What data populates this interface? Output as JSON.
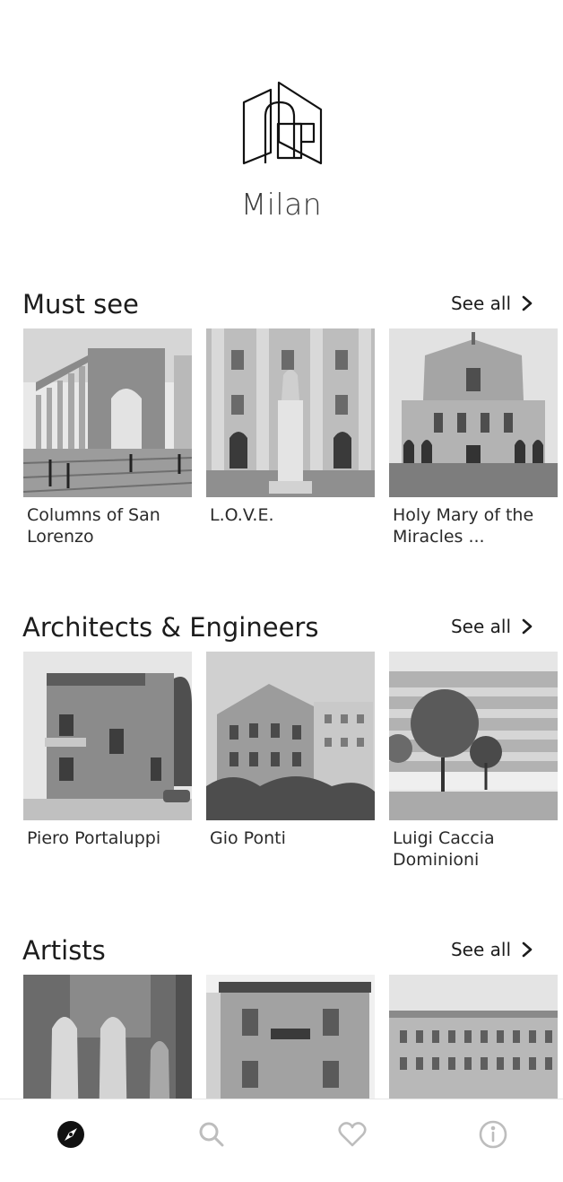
{
  "app": {
    "city": "Milan",
    "logo_icon": "building-logo-icon"
  },
  "sections": [
    {
      "title": "Must see",
      "see_all": "See all",
      "items": [
        {
          "label": "Columns of San Lorenzo"
        },
        {
          "label": "L.O.V.E."
        },
        {
          "label": "Holy Mary of the Miracles ..."
        }
      ]
    },
    {
      "title": "Architects & Engineers",
      "see_all": "See all",
      "items": [
        {
          "label": "Piero Portaluppi"
        },
        {
          "label": "Gio Ponti"
        },
        {
          "label": "Luigi Caccia Dominioni"
        }
      ]
    },
    {
      "title": "Artists",
      "see_all": "See all",
      "items": [
        {
          "label": ""
        },
        {
          "label": ""
        },
        {
          "label": ""
        }
      ]
    }
  ],
  "tabbar": {
    "items": [
      {
        "icon": "compass-icon",
        "active": true
      },
      {
        "icon": "search-icon",
        "active": false
      },
      {
        "icon": "heart-icon",
        "active": false
      },
      {
        "icon": "info-icon",
        "active": false
      }
    ],
    "active_color": "#111111",
    "inactive_color": "#bdbdbd"
  }
}
